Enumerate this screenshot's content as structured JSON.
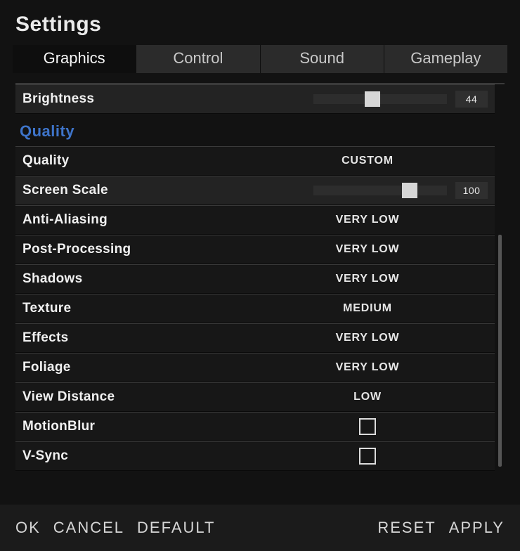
{
  "title": "Settings",
  "tabs": [
    {
      "label": "Graphics",
      "active": true
    },
    {
      "label": "Control",
      "active": false
    },
    {
      "label": "Sound",
      "active": false
    },
    {
      "label": "Gameplay",
      "active": false
    }
  ],
  "section_heading": "Quality",
  "brightness": {
    "label": "Brightness",
    "value": 44,
    "percent": 44
  },
  "screen_scale": {
    "label": "Screen Scale",
    "value": 100,
    "percent": 72
  },
  "rows": {
    "quality": {
      "label": "Quality",
      "value": "CUSTOM"
    },
    "anti_aliasing": {
      "label": "Anti-Aliasing",
      "value": "VERY LOW"
    },
    "post_proc": {
      "label": "Post-Processing",
      "value": "VERY LOW"
    },
    "shadows": {
      "label": "Shadows",
      "value": "VERY LOW"
    },
    "texture": {
      "label": "Texture",
      "value": "MEDIUM"
    },
    "effects": {
      "label": "Effects",
      "value": "VERY LOW"
    },
    "foliage": {
      "label": "Foliage",
      "value": "VERY LOW"
    },
    "view_distance": {
      "label": "View Distance",
      "value": "LOW"
    },
    "motion_blur": {
      "label": "MotionBlur",
      "checked": false
    },
    "vsync": {
      "label": "V-Sync",
      "checked": false
    }
  },
  "footer": {
    "ok": "OK",
    "cancel": "CANCEL",
    "default": "DEFAULT",
    "reset": "RESET",
    "apply": "APPLY"
  }
}
